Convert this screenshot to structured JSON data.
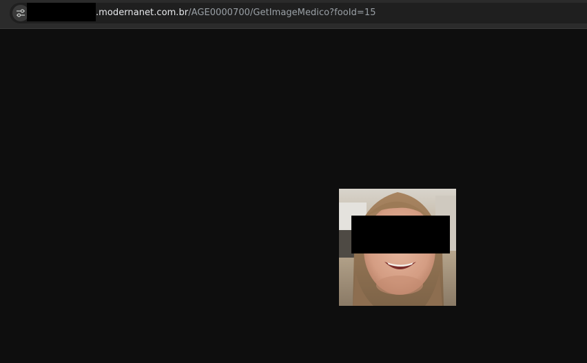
{
  "browser": {
    "site_info_icon": "tune-icon",
    "url": {
      "host_visible": ".modernanet.com.br",
      "path": "/AGE0000700/GetImageMedico?fooId=15"
    }
  },
  "viewer": {
    "image": {
      "subject": "portrait photo",
      "redactions": [
        "eyes-censor-bar"
      ]
    }
  },
  "colors": {
    "background": "#0e0e0e",
    "toolbar": "#2b2b2b",
    "omnibox": "#1f1f1f",
    "url_host": "#e8eaed",
    "url_path": "#9aa0a6"
  }
}
